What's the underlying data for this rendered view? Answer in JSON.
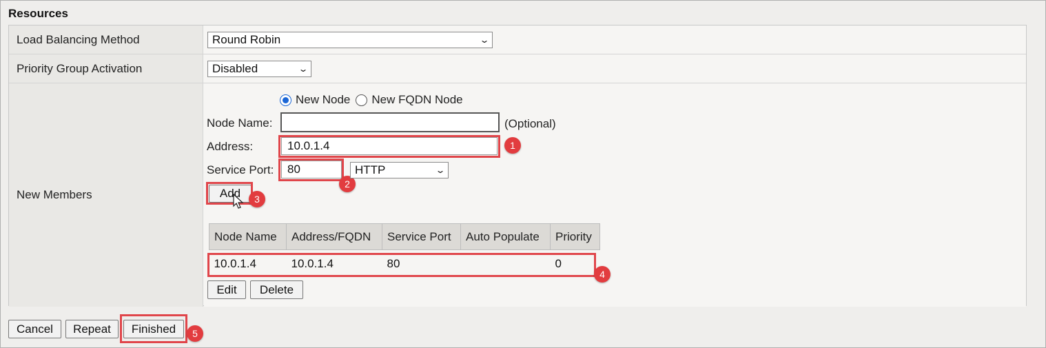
{
  "section_title": "Resources",
  "rows": {
    "lb_method": {
      "label": "Load Balancing Method",
      "value": "Round Robin"
    },
    "priority_group": {
      "label": "Priority Group Activation",
      "value": "Disabled"
    },
    "new_members": {
      "label": "New Members"
    }
  },
  "node_type": {
    "option_new_node": "New Node",
    "option_fqdn": "New FQDN Node",
    "selected": "New Node"
  },
  "node_name": {
    "label": "Node Name:",
    "value": "",
    "hint": "(Optional)"
  },
  "address": {
    "label": "Address:",
    "value": "10.0.1.4"
  },
  "service_port": {
    "label": "Service Port:",
    "value": "80",
    "protocol": "HTTP"
  },
  "add_button": "Add",
  "members_table": {
    "columns": [
      "Node Name",
      "Address/FQDN",
      "Service Port",
      "Auto Populate",
      "Priority"
    ],
    "rows": [
      {
        "node_name": "10.0.1.4",
        "address": "10.0.1.4",
        "port": "80",
        "auto_populate": "",
        "priority": "0"
      }
    ]
  },
  "edit_button": "Edit",
  "delete_button": "Delete",
  "footer": {
    "cancel": "Cancel",
    "repeat": "Repeat",
    "finished": "Finished"
  },
  "callouts": [
    "1",
    "2",
    "3",
    "4",
    "5"
  ],
  "colors": {
    "callout": "#e23c3f",
    "radio_selected": "#1a66d6"
  },
  "icons": {
    "select_arrow": "chevron-down-icon",
    "pointer": "mouse-cursor-icon"
  }
}
